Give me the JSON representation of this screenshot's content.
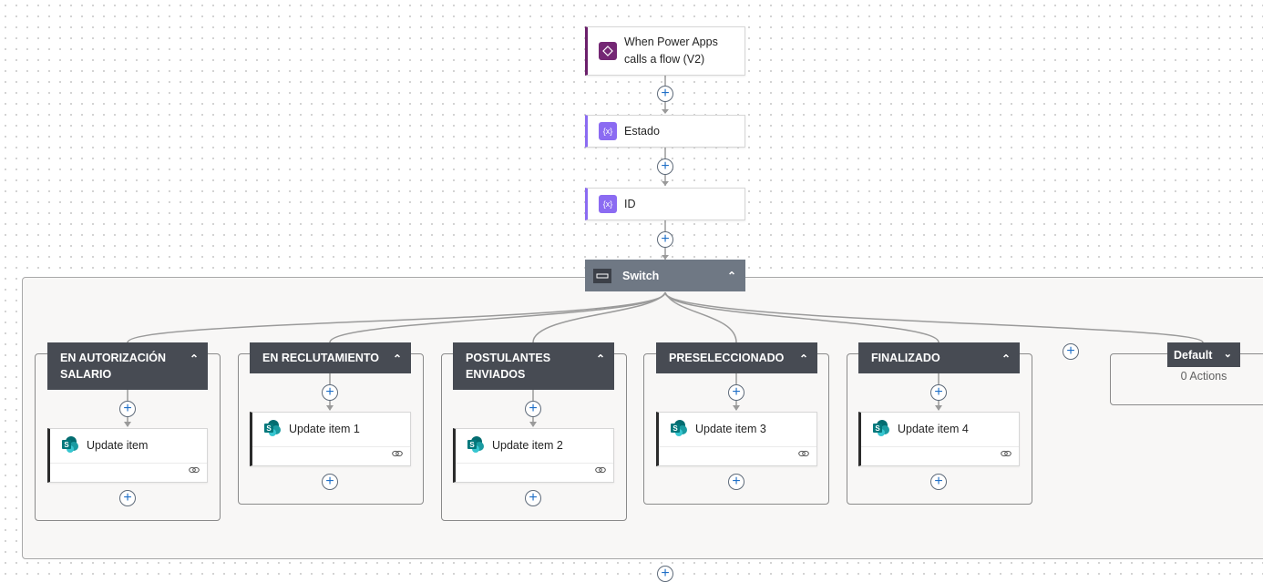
{
  "trigger": {
    "label_line1": "When Power Apps",
    "label_line2": "calls a flow (V2)",
    "icon": "power-apps-icon",
    "color": "#742774"
  },
  "steps": [
    {
      "label": "Estado",
      "icon": "variable-icon",
      "color": "#8b6bf2"
    },
    {
      "label": "ID",
      "icon": "variable-icon",
      "color": "#8b6bf2"
    }
  ],
  "switch": {
    "label": "Switch",
    "icon": "switch-icon",
    "cases": [
      {
        "title_line1": "EN AUTORIZACIÓN",
        "title_line2": "SALARIO",
        "action": "Update item"
      },
      {
        "title_line1": "EN RECLUTAMIENTO",
        "title_line2": "",
        "action": "Update item 1"
      },
      {
        "title_line1": "POSTULANTES",
        "title_line2": "ENVIADOS",
        "action": "Update item 2"
      },
      {
        "title_line1": "PRESELECCIONADO",
        "title_line2": "",
        "action": "Update item 3"
      },
      {
        "title_line1": "FINALIZADO",
        "title_line2": "",
        "action": "Update item 4"
      }
    ],
    "default": {
      "label": "Default",
      "actions_text": "0 Actions"
    }
  },
  "add_symbol": "+",
  "collapse_symbol": "⌃",
  "dropdown_symbol": "⌄"
}
